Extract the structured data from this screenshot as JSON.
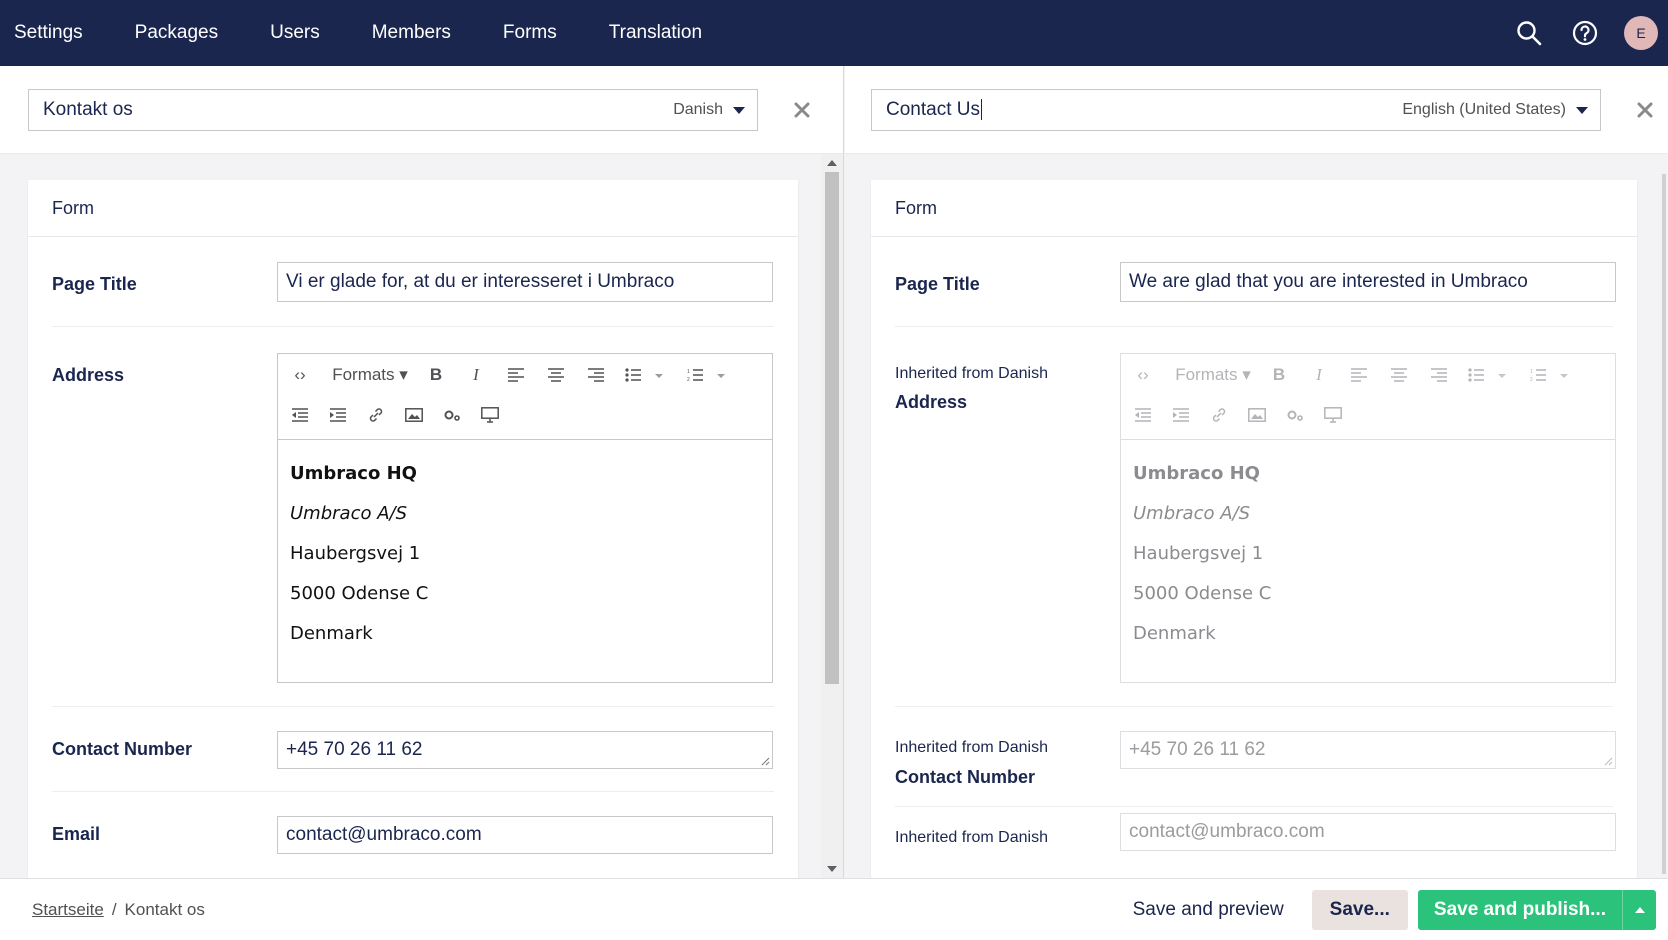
{
  "nav": {
    "sections": [
      "Settings",
      "Packages",
      "Users",
      "Members",
      "Forms",
      "Translation"
    ],
    "avatar_initial": "E"
  },
  "left": {
    "name": "Kontakt os",
    "language": "Danish",
    "group": "Form",
    "page_title_label": "Page Title",
    "page_title_value": "Vi er glade for, at du er interesseret i Umbraco",
    "address_label": "Address",
    "contact_number_label": "Contact Number",
    "contact_number_value": "+45 70 26 11 62",
    "email_label": "Email",
    "email_value": "contact@umbraco.com"
  },
  "right": {
    "name": "Contact Us",
    "language": "English (United States)",
    "group": "Form",
    "page_title_label": "Page Title",
    "page_title_value": "We are glad that you are interested in Umbraco",
    "inherit_note": "Inherited from Danish",
    "address_label": "Address",
    "contact_number_label": "Contact Number",
    "contact_number_value": "+45 70 26 11 62",
    "email_value": "contact@umbraco.com"
  },
  "rte": {
    "formats_label": "Formats",
    "address_lines": [
      "Umbraco HQ",
      "Umbraco A/S",
      "Haubergsvej 1",
      "5000 Odense C",
      "Denmark"
    ]
  },
  "breadcrumb": {
    "root": "Startseite",
    "separator": "/",
    "current": "Kontakt os"
  },
  "actions": {
    "save_preview": "Save and preview",
    "save": "Save...",
    "publish": "Save and publish..."
  }
}
